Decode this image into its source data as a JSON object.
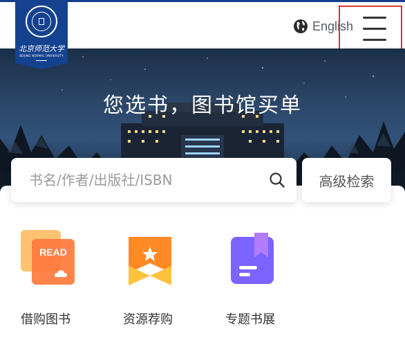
{
  "header": {
    "logo": {
      "chinese_name": "北京师范大学",
      "english_name": "BEIJING NORMAL UNIVERSITY"
    },
    "language_label": "English",
    "language_icon": "globe-icon",
    "menu_icon": "hamburger-menu-icon"
  },
  "hero": {
    "title": "您选书，图书馆买单"
  },
  "search": {
    "placeholder": "书名/作者/出版社/ISBN",
    "value": "",
    "icon": "search-icon",
    "advanced_label": "高级检索"
  },
  "services": [
    {
      "label": "借购图书",
      "icon": "read-card-icon",
      "badge_text": "READ",
      "colors": [
        "#ffb75a",
        "#ff7a3d"
      ]
    },
    {
      "label": "资源荐购",
      "icon": "star-ribbon-icon",
      "colors": [
        "#ff8a26",
        "#ffc23d"
      ]
    },
    {
      "label": "专题书展",
      "icon": "bookmark-book-icon",
      "colors": [
        "#7c63ff",
        "#b27cff"
      ]
    }
  ],
  "colors": {
    "brand": "#14428f",
    "highlight_border": "#e02f2f",
    "text": "#333333",
    "placeholder": "#9a9a9a"
  }
}
